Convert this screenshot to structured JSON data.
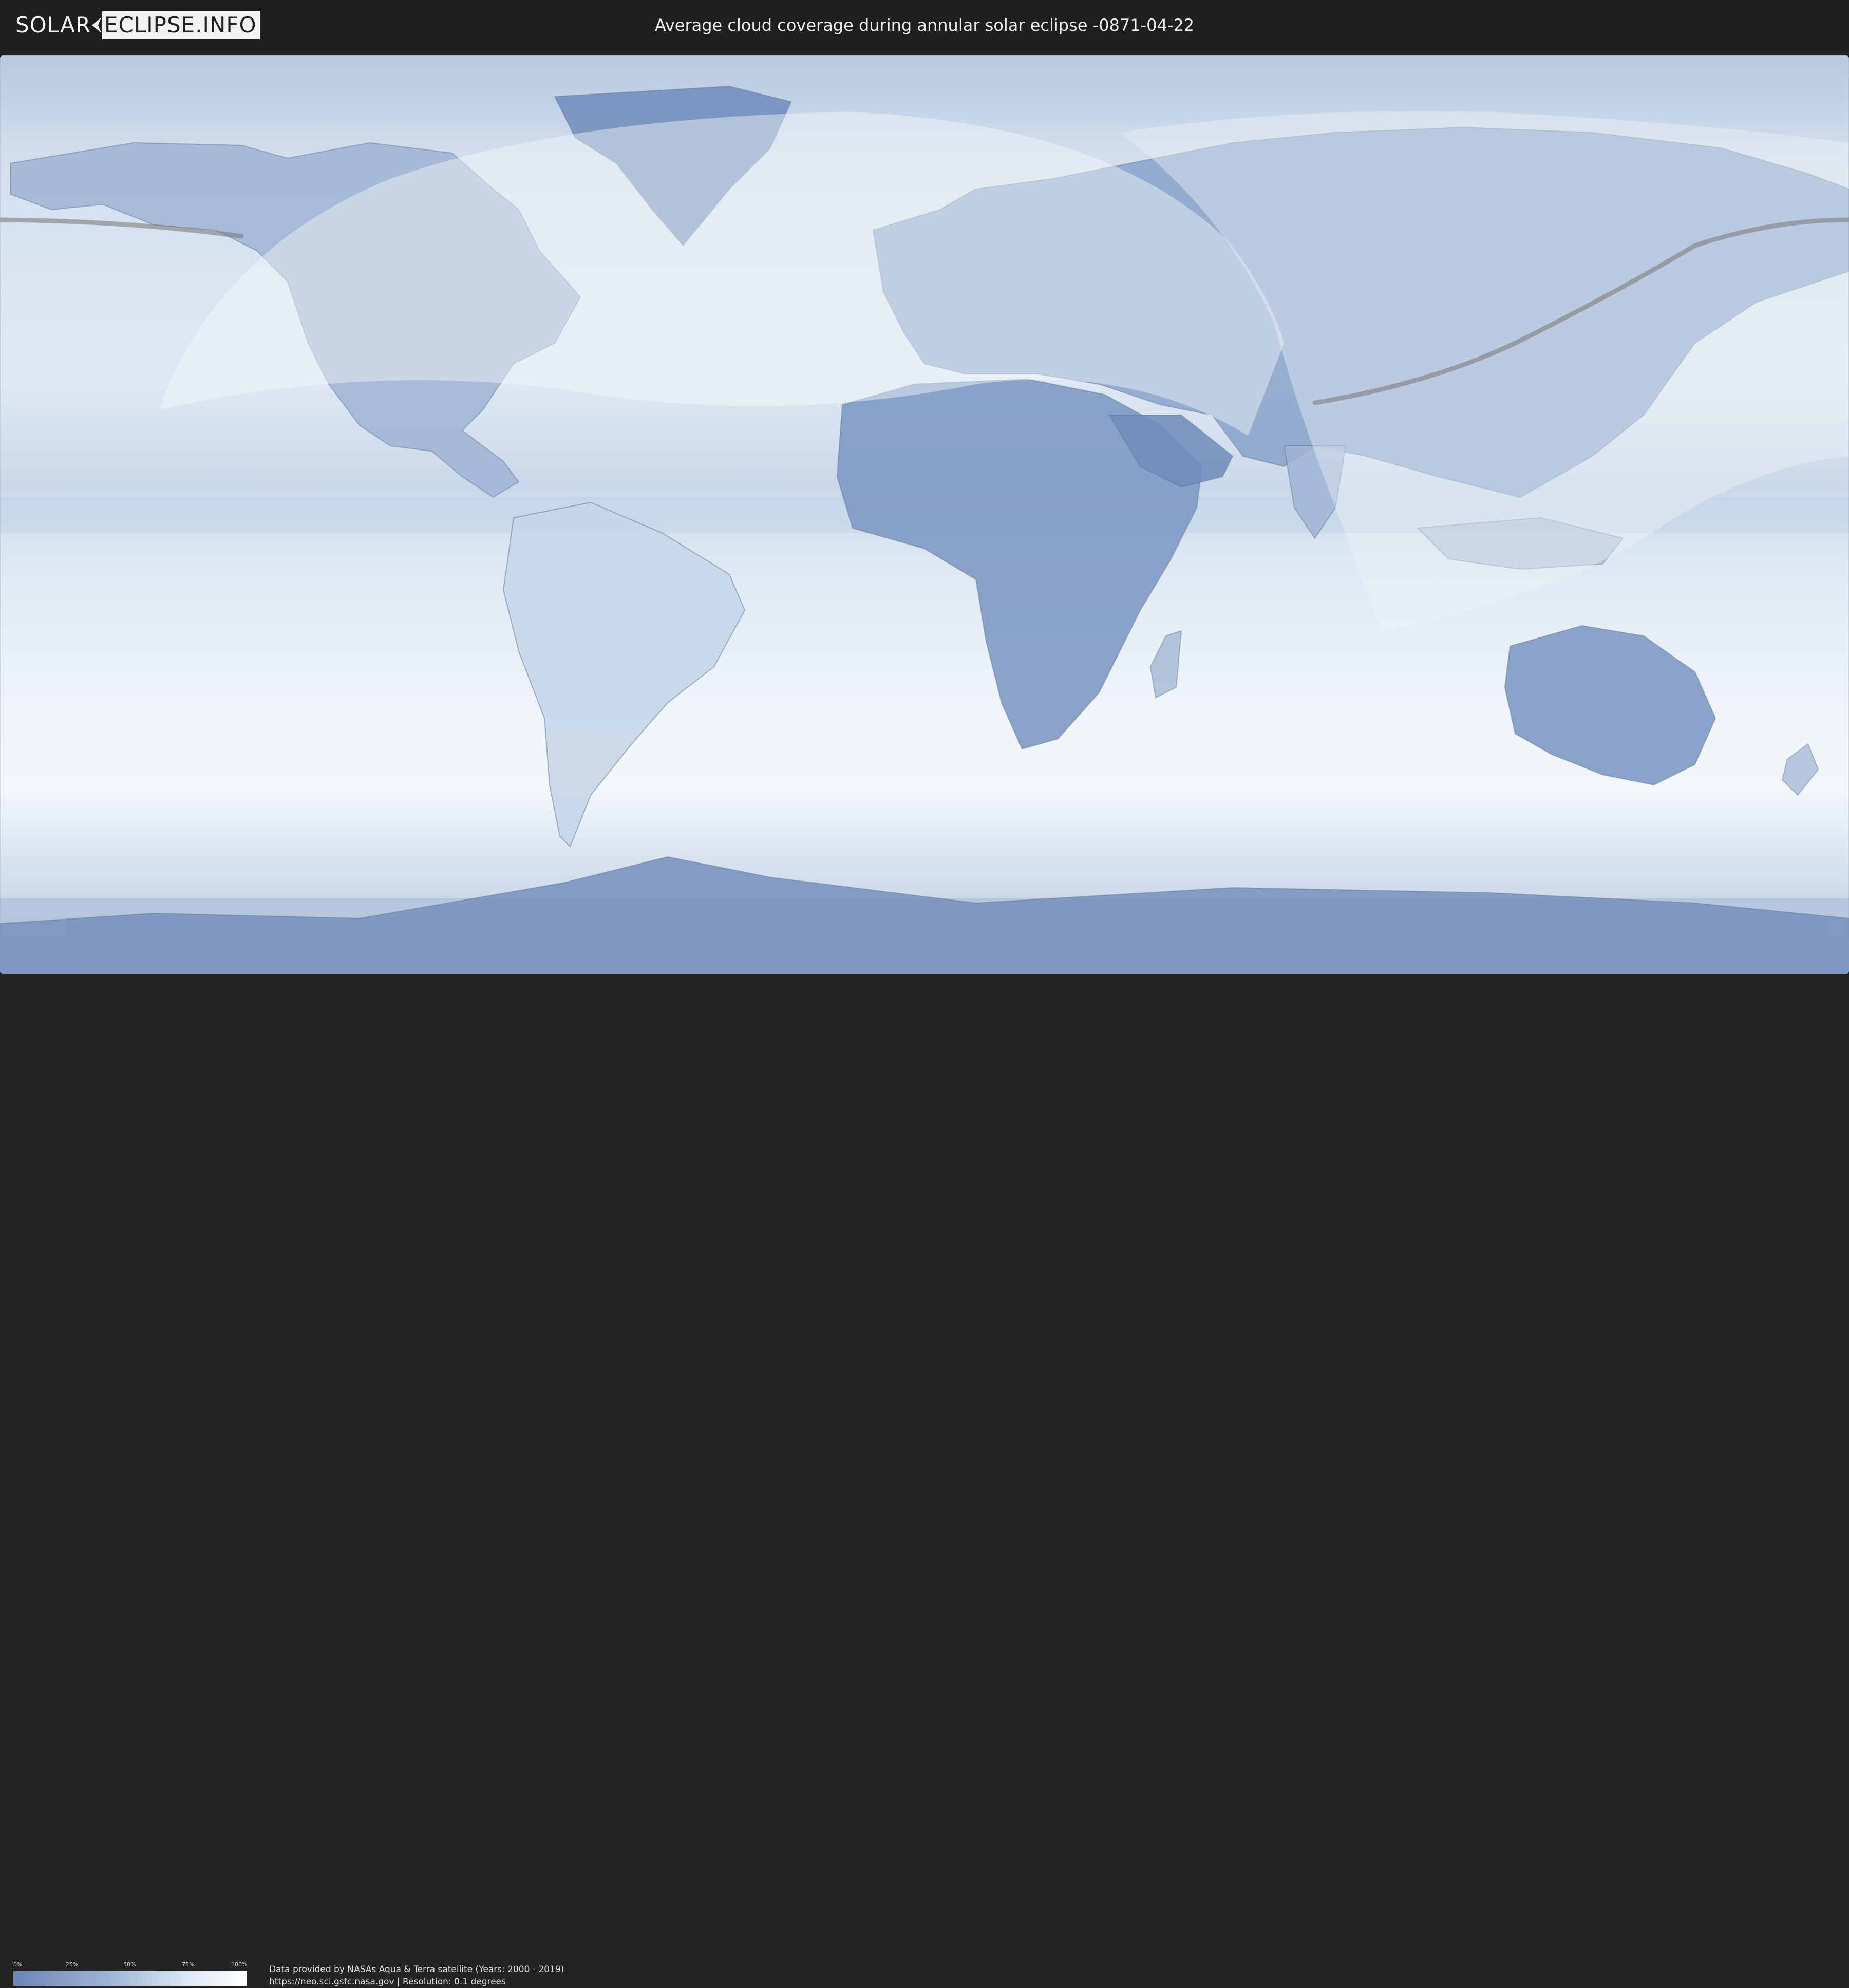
{
  "header": {
    "logo_left": "SOLAR",
    "logo_right": "ECLIPSE.INFO",
    "title": "Average cloud coverage during annular solar eclipse -0871-04-22"
  },
  "legend": {
    "ticks": [
      "0%",
      "25%",
      "50%",
      "75%",
      "100%"
    ],
    "tick_values": [
      0,
      25,
      50,
      75,
      100
    ],
    "colors": {
      "low": "#6b86b6",
      "mid": "#9cb3d6",
      "high": "#ffffff"
    }
  },
  "footer": {
    "credit_line1": "Data provided by NASAs Aqua & Terra satellite (Years: 2000 - 2019)",
    "credit_line2": "https://neo.sci.gsfc.nasa.gov | Resolution: 0.1 degrees"
  },
  "map": {
    "projection": "equirectangular",
    "ocean_color": "#d9e5f1",
    "land_color": "#6f8cbc",
    "eclipse_visibility_color": "#eef3f8",
    "central_path_color": "#7d7d7d"
  }
}
